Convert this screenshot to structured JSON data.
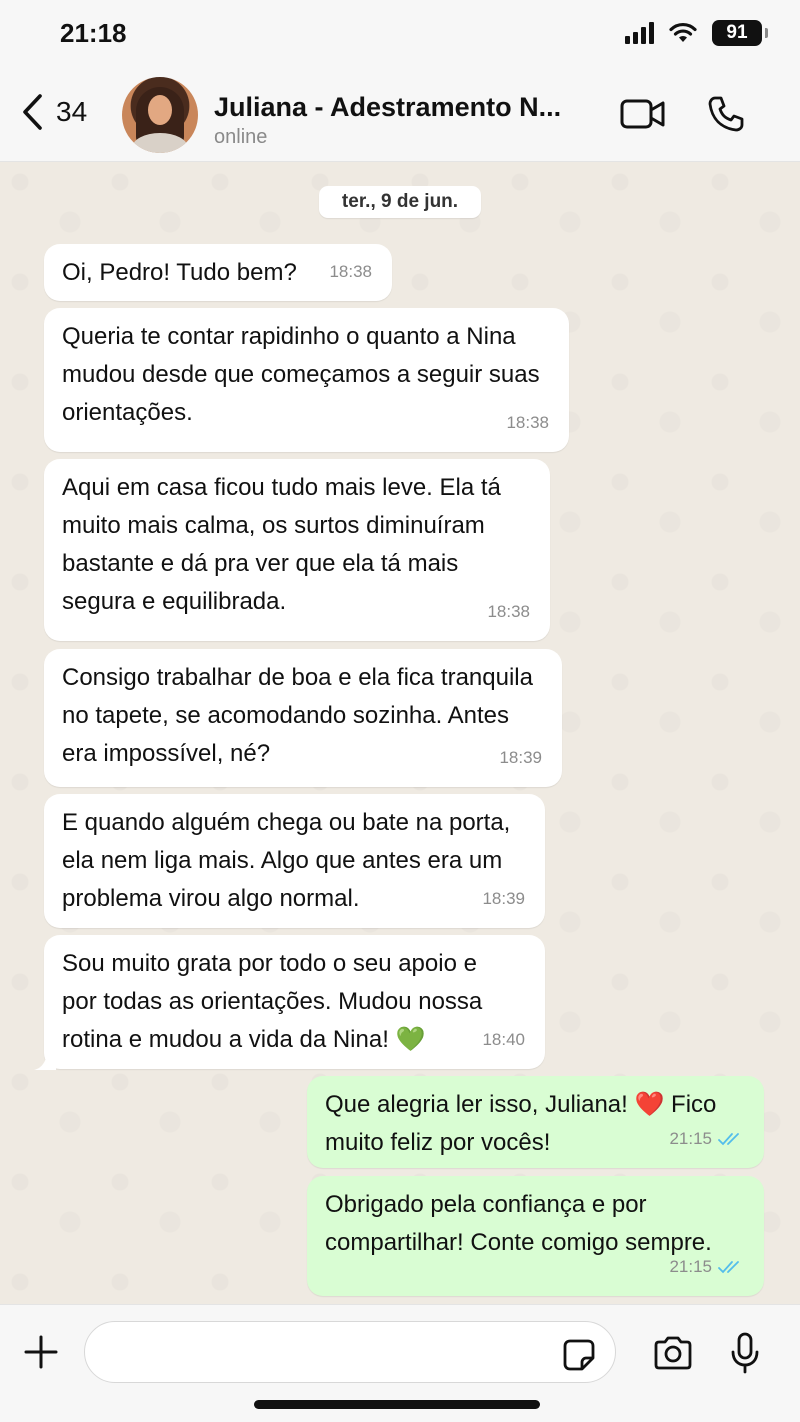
{
  "status_bar": {
    "time": "21:18",
    "battery": "91"
  },
  "header": {
    "back_count": "34",
    "contact_name": "Juliana - Adestramento N...",
    "contact_status": "online"
  },
  "chat": {
    "date": "ter., 9 de jun.",
    "messages": [
      {
        "direction": "incoming",
        "text": "Oi, Pedro! Tudo bem?",
        "time": "18:38"
      },
      {
        "direction": "incoming",
        "text": "Queria te contar rapidinho o quanto a Nina\nmudou desde que começamos a seguir suas\norientações.",
        "time": "18:38"
      },
      {
        "direction": "incoming",
        "text": "Aqui em casa ficou tudo mais leve. Ela tá\nmuito mais calma, os surtos diminuíram\nbastante e dá pra ver que ela tá mais\nsegura e equilibrada.",
        "time": "18:38"
      },
      {
        "direction": "incoming",
        "text": "Consigo trabalhar de boa e ela fica tranquila\nno tapete, se acomodando sozinha. Antes\nera impossível, né?",
        "time": "18:39"
      },
      {
        "direction": "incoming",
        "text": "E quando alguém chega ou bate na porta,\nela nem liga mais. Algo que antes era um\nproblema virou algo normal.",
        "time": "18:39"
      },
      {
        "direction": "incoming",
        "text": "Sou muito grata por todo o seu apoio e\npor todas as orientações. Mudou nossa\nrotina e mudou a vida da Nina! 💚",
        "time": "18:40"
      },
      {
        "direction": "outgoing",
        "text": "Que alegria ler isso, Juliana! ❤️ Fico\nmuito feliz por vocês!",
        "time": "21:15",
        "status": "read"
      },
      {
        "direction": "outgoing",
        "text": "Obrigado pela confiança e por\ncompartilhar! Conte comigo sempre.",
        "time": "21:15",
        "status": "read"
      }
    ]
  },
  "composer": {
    "placeholder": ""
  },
  "colors": {
    "incoming_bubble": "#ffffff",
    "outgoing_bubble": "#d9fdd3",
    "chat_background": "#efeae2",
    "read_ticks": "#53bdeb"
  },
  "icons": {
    "back": "chevron-left-icon",
    "video": "video-camera-icon",
    "call": "phone-icon",
    "plus": "plus-icon",
    "sticker": "sticker-icon",
    "camera": "camera-icon",
    "mic": "microphone-icon"
  }
}
